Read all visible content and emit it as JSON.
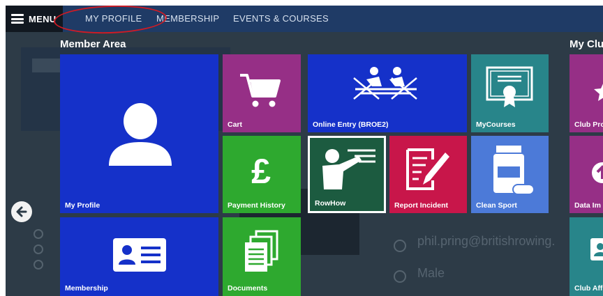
{
  "topbar": {
    "menu_label": "MENU",
    "links": [
      "MY PROFILE",
      "MEMBERSHIP",
      "EVENTS & COURSES"
    ]
  },
  "background": {
    "email": "phil.pring@britishrowing.",
    "gender": "Male"
  },
  "member_area": {
    "title": "Member Area",
    "tiles": {
      "my_profile": "My Profile",
      "cart": "Cart",
      "online_entry": "Online Entry (BROE2)",
      "my_courses": "MyCourses",
      "payment_history": "Payment History",
      "rowhow": "RowHow",
      "report_incident": "Report Incident",
      "clean_sport": "Clean Sport",
      "membership": "Membership",
      "documents": "Documents"
    }
  },
  "club_area": {
    "title": "My Clu",
    "tiles": {
      "club_profile": "Club Pro",
      "data_import": "Data Im",
      "club_affiliation": "Club Aff"
    }
  },
  "colors": {
    "blue": "#1531c9",
    "purple": "#962f86",
    "green": "#2ea92f",
    "teal": "#28858a",
    "dark_green": "#1c5b40",
    "crimson": "#c8164a",
    "light_blue": "#4c7ad8",
    "annotation_red": "#d01b24"
  }
}
